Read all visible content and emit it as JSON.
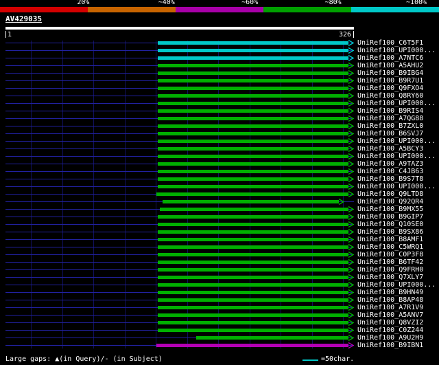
{
  "scale_bar": {
    "labels": [
      "20%",
      "~40%",
      "~60%",
      "~80%",
      "~100%"
    ],
    "colors": [
      "#d40000",
      "#c86400",
      "#a800a8",
      "#00a000",
      "#00c8c8"
    ]
  },
  "query": {
    "name": "AV429035",
    "start_label": "1",
    "end_label": "326"
  },
  "footer": {
    "legend_text": "Large gaps: ▲(in Query)/- (in Subject)",
    "ruler_label": "=50char.",
    "ruler_color": "#00c8c8"
  },
  "chart_data": {
    "type": "bar",
    "subtype": "alignment-hit-overview",
    "query_name": "AV429035",
    "query_length": 326,
    "axis": {
      "start": 1,
      "end": 326
    },
    "palette": {
      "cyan": "#00c8c8",
      "green": "#00b000",
      "magenta": "#b400b4"
    },
    "hits": [
      {
        "label": "UniRef100_C6T5F1",
        "color": "cyan",
        "start": 143,
        "end": 326
      },
      {
        "label": "UniRef100_UPI000...",
        "color": "cyan",
        "start": 143,
        "end": 326
      },
      {
        "label": "UniRef100_A7NTC6",
        "color": "cyan",
        "start": 143,
        "end": 326
      },
      {
        "label": "UniRef100_A5AHU2",
        "color": "green",
        "start": 143,
        "end": 326
      },
      {
        "label": "UniRef100_B9IBG4",
        "color": "green",
        "start": 143,
        "end": 326
      },
      {
        "label": "UniRef100_B9R7U1",
        "color": "green",
        "start": 143,
        "end": 326
      },
      {
        "label": "UniRef100_Q9FXO4",
        "color": "green",
        "start": 143,
        "end": 326
      },
      {
        "label": "UniRef100_Q8RY60",
        "color": "green",
        "start": 143,
        "end": 326
      },
      {
        "label": "UniRef100_UPI000...",
        "color": "green",
        "start": 143,
        "end": 326
      },
      {
        "label": "UniRef100_B9RIS4",
        "color": "green",
        "start": 143,
        "end": 326
      },
      {
        "label": "UniRef100_A7QG88",
        "color": "green",
        "start": 143,
        "end": 326
      },
      {
        "label": "UniRef100_B7ZXL0",
        "color": "green",
        "start": 143,
        "end": 326
      },
      {
        "label": "UniRef100_B6SVJ7",
        "color": "green",
        "start": 143,
        "end": 326
      },
      {
        "label": "UniRef100_UPI000...",
        "color": "green",
        "start": 143,
        "end": 326
      },
      {
        "label": "UniRef100_A5BCY3",
        "color": "green",
        "start": 143,
        "end": 326
      },
      {
        "label": "UniRef100_UPI000...",
        "color": "green",
        "start": 143,
        "end": 326
      },
      {
        "label": "UniRef100_A9TAZ3",
        "color": "green",
        "start": 143,
        "end": 326
      },
      {
        "label": "UniRef100_C4JB63",
        "color": "green",
        "start": 143,
        "end": 326
      },
      {
        "label": "UniRef100_B9S7T8",
        "color": "green",
        "start": 143,
        "end": 326
      },
      {
        "label": "UniRef100_UPI000...",
        "color": "green",
        "start": 143,
        "end": 326
      },
      {
        "label": "UniRef100_Q9LTD8",
        "color": "green",
        "start": 142,
        "end": 326
      },
      {
        "label": "UniRef100_Q92QR4",
        "color": "green",
        "start": 148,
        "end": 317
      },
      {
        "label": "UniRef100_B9MX55",
        "color": "green",
        "start": 145,
        "end": 326
      },
      {
        "label": "UniRef100_B9GIP7",
        "color": "green",
        "start": 143,
        "end": 326
      },
      {
        "label": "UniRef100_Q10SE0",
        "color": "green",
        "start": 143,
        "end": 326
      },
      {
        "label": "UniRef100_B9SX86",
        "color": "green",
        "start": 143,
        "end": 326
      },
      {
        "label": "UniRef100_B8AMF1",
        "color": "green",
        "start": 143,
        "end": 326
      },
      {
        "label": "UniRef100_C5WRQ1",
        "color": "green",
        "start": 143,
        "end": 326
      },
      {
        "label": "UniRef100_C0P3F8",
        "color": "green",
        "start": 143,
        "end": 326
      },
      {
        "label": "UniRef100_B6TF42",
        "color": "green",
        "start": 143,
        "end": 326
      },
      {
        "label": "UniRef100_Q9FRH0",
        "color": "green",
        "start": 143,
        "end": 326
      },
      {
        "label": "UniRef100_Q7XLY7",
        "color": "green",
        "start": 143,
        "end": 326
      },
      {
        "label": "UniRef100_UPI000...",
        "color": "green",
        "start": 143,
        "end": 326
      },
      {
        "label": "UniRef100_B9HN49",
        "color": "green",
        "start": 143,
        "end": 326
      },
      {
        "label": "UniRef100_B8AP48",
        "color": "green",
        "start": 143,
        "end": 326
      },
      {
        "label": "UniRef100_A7R1V9",
        "color": "green",
        "start": 143,
        "end": 326
      },
      {
        "label": "UniRef100_A5ANV7",
        "color": "green",
        "start": 143,
        "end": 326
      },
      {
        "label": "UniRef100_Q8VZI2",
        "color": "green",
        "start": 143,
        "end": 326
      },
      {
        "label": "UniRef100_C0Z244",
        "color": "green",
        "start": 143,
        "end": 326
      },
      {
        "label": "UniRef100_A9U2H9",
        "color": "green",
        "start": 179,
        "end": 326
      },
      {
        "label": "UniRef100_B9IBN1",
        "color": "magenta",
        "start": 142,
        "end": 326
      }
    ]
  }
}
